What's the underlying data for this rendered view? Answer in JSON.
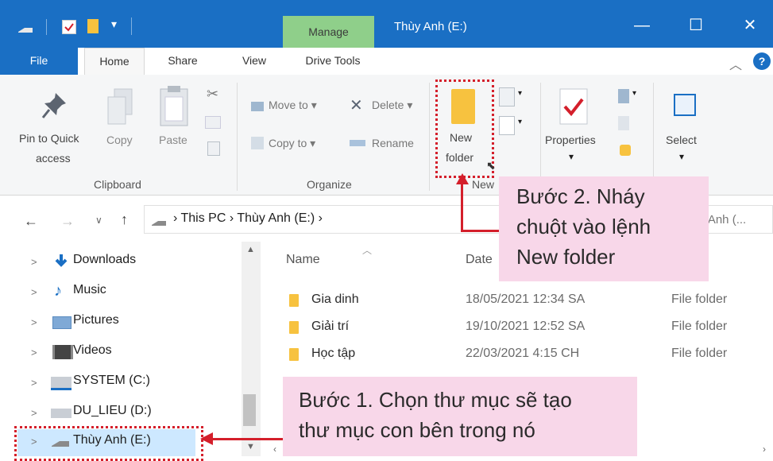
{
  "window": {
    "title": "Thùy Anh (E:)",
    "context_tab": "Manage",
    "minimize": "—",
    "maximize": "☐",
    "close": "✕"
  },
  "ribbon_tabs": [
    "File",
    "Home",
    "Share",
    "View",
    "Drive Tools"
  ],
  "ribbon": {
    "pin_label_1": "Pin to Quick",
    "pin_label_2": "access",
    "copy": "Copy",
    "paste": "Paste",
    "move_to": "Move to",
    "copy_to": "Copy to",
    "delete": "Delete",
    "rename": "Rename",
    "new_folder_1": "New",
    "new_folder_2": "folder",
    "properties": "Properties",
    "select": "Select",
    "group_clipboard": "Clipboard",
    "group_organize": "Organize",
    "group_new": "New"
  },
  "address": {
    "path_root": "This PC",
    "path_drive": "Thùy Anh (E:)",
    "search_partial": "y Anh (..."
  },
  "nav": [
    {
      "label": "Downloads"
    },
    {
      "label": "Music"
    },
    {
      "label": "Pictures"
    },
    {
      "label": "Videos"
    },
    {
      "label": "SYSTEM (C:)"
    },
    {
      "label": "DU_LIEU (D:)"
    },
    {
      "label": "Thùy Anh (E:)"
    }
  ],
  "columns": {
    "name": "Name",
    "date": "Date"
  },
  "files": [
    {
      "name": "Gia dinh",
      "date": "18/05/2021 12:34 SA",
      "type": "File folder"
    },
    {
      "name": "Giải trí",
      "date": "19/10/2021 12:52 SA",
      "type": "File folder"
    },
    {
      "name": "Học tập",
      "date": "22/03/2021 4:15 CH",
      "type": "File folder"
    }
  ],
  "callouts": {
    "step2_line1": "Bước 2. Nháy",
    "step2_line2": "chuột vào lệnh",
    "step2_line3": "New folder",
    "step1_line1": "Bước 1. Chọn thư mục sẽ tạo",
    "step1_line2": "thư mục con bên trong nó"
  },
  "colors": {
    "titlebar": "#1a6fc4",
    "manage_tab": "#8fcf8a",
    "callout_bg": "#f8d7e9",
    "highlight": "#d41f2b",
    "folder": "#f7c23f"
  }
}
